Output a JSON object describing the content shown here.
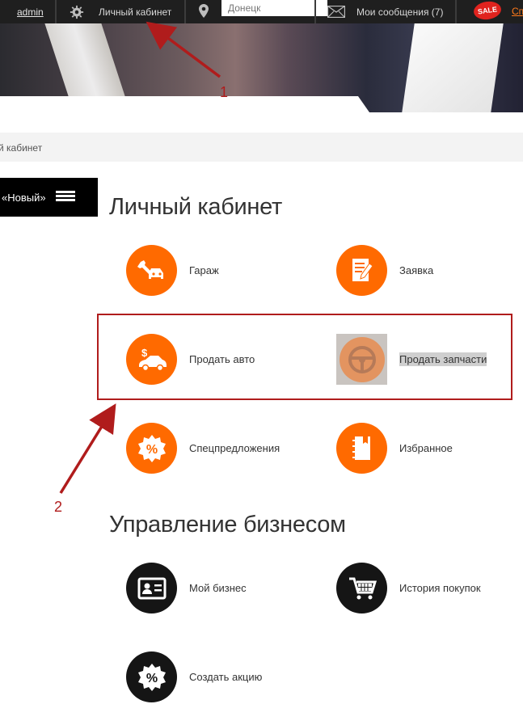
{
  "topbar": {
    "user": "admin",
    "cabinet": "Личный кабинет",
    "city_placeholder": "Донецк",
    "messages": "Мои сообщения (7)",
    "sale_badge": "SALE",
    "sale_link": "Сп"
  },
  "breadcrumb": "й кабинет",
  "menu_button": "«Новый»",
  "sections": {
    "personal": {
      "title": "Личный кабинет",
      "items": [
        {
          "label": "Гараж",
          "icon": "wrench-car-icon"
        },
        {
          "label": "Заявка",
          "icon": "document-edit-icon"
        },
        {
          "label": "Продать авто",
          "icon": "car-dollar-icon"
        },
        {
          "label": "Продать запчасти",
          "icon": "steering-wheel-icon"
        },
        {
          "label": "Спецпредложения",
          "icon": "percent-badge-icon"
        },
        {
          "label": "Избранное",
          "icon": "notebook-icon"
        }
      ]
    },
    "business": {
      "title": "Управление бизнесом",
      "items": [
        {
          "label": "Мой бизнес",
          "icon": "id-card-icon"
        },
        {
          "label": "История покупок",
          "icon": "shopping-cart-icon"
        },
        {
          "label": "Создать акцию",
          "icon": "percent-badge-icon"
        }
      ]
    }
  },
  "annotations": {
    "one": "1",
    "two": "2"
  },
  "colors": {
    "accent": "#ff6a00",
    "annotation": "#b01c1c",
    "topbar": "#1f1f1f"
  }
}
